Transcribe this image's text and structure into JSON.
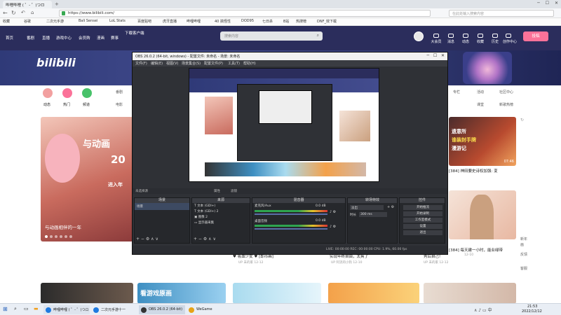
{
  "browser": {
    "tabs": [
      "哔哩哔哩 ( ゜- ゜)つロ",
      "二次元手游十一"
    ],
    "url": "https://www.bilibili.com/",
    "search_placeholder": "在此处输入搜索内容",
    "bookmarks": [
      "收藏",
      "谷歌",
      "二次元手游",
      "Bali Sensei",
      "LoL Stats",
      "百度贴吧",
      "虎牙直播",
      "哔哩哔哩",
      "40 搞怪性",
      "DOD95",
      "七日杀",
      "B站",
      "热搜榜",
      "DNF_效下载"
    ]
  },
  "bili": {
    "nav": [
      "首页",
      "番剧",
      "直播",
      "游戏中心",
      "会员购",
      "漫画",
      "赛事",
      "下载客户端"
    ],
    "search_placeholder": "搜索内容",
    "right_nav": [
      "大会员",
      "消息",
      "动态",
      "收藏",
      "历史",
      "创作中心"
    ],
    "upload": "投稿",
    "logo": "bilibili",
    "categories": [
      "动态",
      "热门",
      "频道"
    ],
    "cat_words": [
      "番剧",
      "电影"
    ],
    "right_links": [
      "专栏",
      "活动",
      "社区中心",
      "课堂",
      "新歌热榜"
    ],
    "carousel_text": "与动画相伴的一年",
    "carousel_big": "与动画",
    "carousel_num": "20",
    "carousel_sub": "进入年",
    "right_video_text": "遗意所",
    "right_video_badge": "谁装封手牌",
    "right_video_badge2": "漫游记",
    "right_video_caption": "[384] 神田要史诗权加强: 变",
    "right_video_time": "07:46",
    "card_captions": [
      "♥ 吸血少女 ♥ [即币画]",
      "实现年终自由，太爽了",
      "秀后自己!",
      "[384] 每天建一小时，能业绿带"
    ],
    "card_subs": [
      "UP 未的家 12-12",
      "UP 阿流的小狗 12-10",
      "UP 未的家 12-12",
      "12-10"
    ],
    "bottom_banner": "看游戏原画",
    "right_side": [
      "新年",
      "画",
      "反馈",
      "客服"
    ]
  },
  "obs": {
    "title": "OBS 26.0.2 (64-bit, windows) - 配置文件: 未命名 - 场景: 未命名",
    "menu": [
      "文件(F)",
      "编辑(E)",
      "视图(V)",
      "场景集合(S)",
      "配置文件(P)",
      "工具(T)",
      "帮助(H)"
    ],
    "preview_bar": [
      "未选择源",
      "属性",
      "滤镜"
    ],
    "panels": [
      "场景",
      "来源",
      "混音器",
      "转场特效",
      "控件"
    ],
    "scene_items": [
      "场景"
    ],
    "sources": [
      "文本 (GDI+)",
      "文本 (GDI+) 2",
      "图像 2",
      "显示器采集"
    ],
    "mixer": [
      "麦克风/Aux",
      "桌面音频"
    ],
    "mixer_db": [
      "0.0 dB",
      "0.0 dB"
    ],
    "transition_type": "淡出",
    "transition_label": "时长",
    "transition_value": "300 ms",
    "controls": [
      "开始推流",
      "开始录制",
      "工作室模式",
      "设置",
      "退出"
    ],
    "status": "LIVE: 00:00:00   REC: 00:00:00   CPU: 1.9%, 60.00 fps"
  },
  "taskbar": {
    "apps": [
      "哔哩哔哩 ( ゜- ゜)つロ",
      "二次元手游十一",
      "OBS 26.0.2 (64-bit)",
      "WeGame"
    ],
    "time": "21:53",
    "date": "2022/12/12"
  },
  "colors": {
    "bili_pink": "#fb7299",
    "bili_blue": "#00a1d6",
    "header_bg": "#2b2d5c",
    "obs_bg": "#2f3136"
  }
}
